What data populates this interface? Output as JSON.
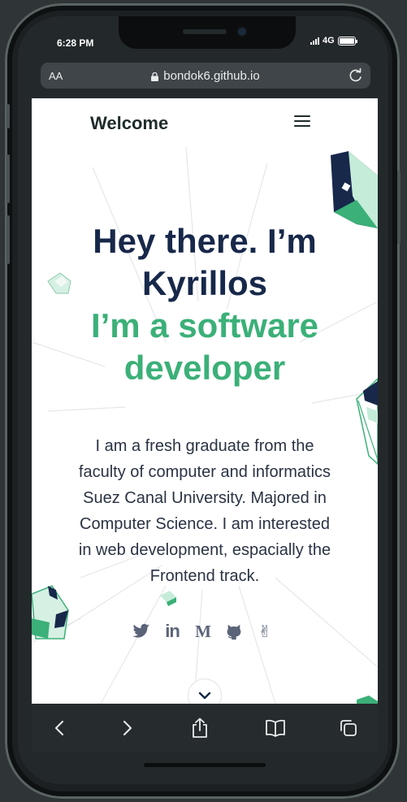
{
  "status_bar": {
    "time": "6:28 PM",
    "network": "4G"
  },
  "browser": {
    "text_size_label": "AA",
    "url": "bondok6.github.io"
  },
  "nav": {
    "title": "Welcome"
  },
  "hero": {
    "line1": "Hey there. I’m",
    "line2": "Kyrillos",
    "line3": "I’m a software",
    "line4": "developer"
  },
  "bio": {
    "lines": [
      "I am a fresh graduate from the",
      "faculty of computer and informatics",
      "Suez Canal University. Majored in",
      "Computer Science. I am interested",
      "in web development, espacially the",
      "Frontend track."
    ]
  },
  "social": {
    "items": [
      {
        "icon": "twitter-icon"
      },
      {
        "icon": "linkedin-icon",
        "glyph": "in"
      },
      {
        "icon": "medium-icon",
        "glyph": "M"
      },
      {
        "icon": "github-icon"
      },
      {
        "icon": "victory-hand-icon",
        "glyph": "✌"
      }
    ]
  },
  "colors": {
    "navy": "#17284a",
    "green": "#3bb078",
    "text": "#2a3344",
    "icon": "#5a6378",
    "browser_chrome": "#262b2e"
  }
}
